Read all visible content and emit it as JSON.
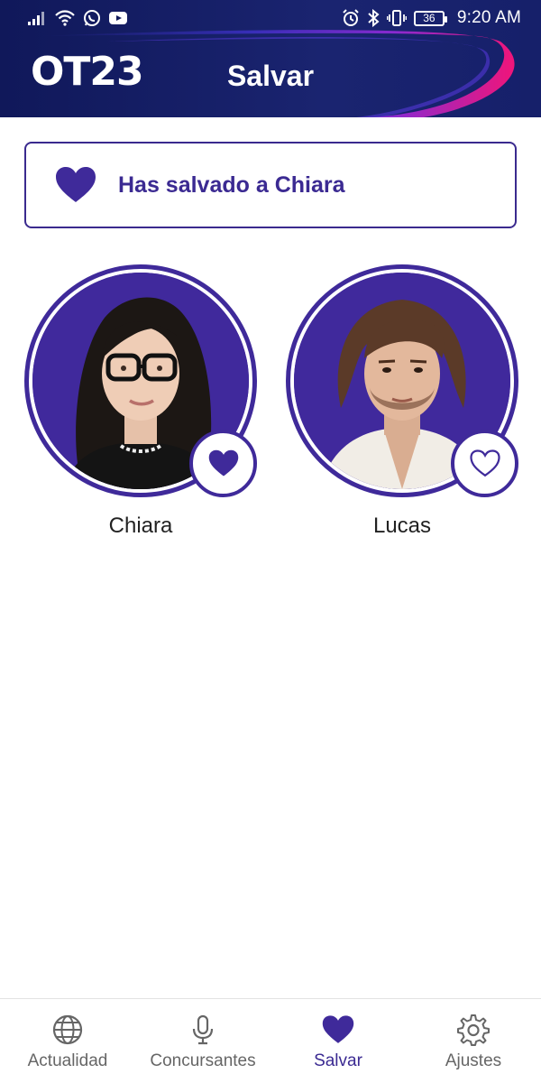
{
  "status_bar": {
    "time": "9:20 AM",
    "battery": "36"
  },
  "header": {
    "logo": "OT23",
    "title": "Salvar"
  },
  "saved_message": {
    "text": "Has salvado a Chiara"
  },
  "contestants": [
    {
      "name": "Chiara",
      "saved": true
    },
    {
      "name": "Lucas",
      "saved": false
    }
  ],
  "bottom_nav": {
    "items": [
      {
        "label": "Actualidad",
        "icon": "globe-icon",
        "active": false
      },
      {
        "label": "Concursantes",
        "icon": "microphone-icon",
        "active": false
      },
      {
        "label": "Salvar",
        "icon": "heart-icon",
        "active": true
      },
      {
        "label": "Ajustes",
        "icon": "gear-icon",
        "active": false
      }
    ]
  },
  "colors": {
    "brand_purple": "#3b2a92",
    "header_navy": "#111a5c",
    "accent_pink": "#e0187e"
  }
}
